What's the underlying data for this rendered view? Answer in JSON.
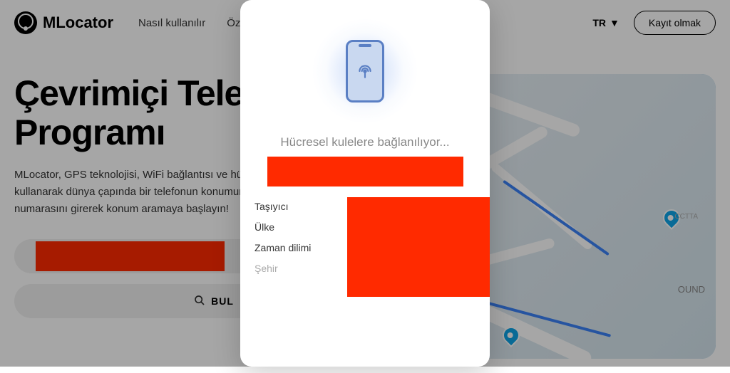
{
  "header": {
    "logo_text": "MLocator",
    "nav": [
      "Nasıl kullanılır",
      "Özellik"
    ],
    "lang": "TR",
    "signup": "Kayıt olmak"
  },
  "hero": {
    "title": "Çevrimiçi Telefon Takip Programı",
    "desc": "MLocator, GPS teknolojisi, WiFi bağlantısı ve hücresel sinyal üçgenlemesini kullanarak dünya çapında bir telefonun konumunu izler. Arama kutusuna telefon numarasını girerek konum aramaya başlayın!",
    "find_button": "BUL"
  },
  "map": {
    "label1": "OUND",
    "label2": "CCTTA"
  },
  "modal": {
    "status": "Hücresel kulelere bağlanılıyor...",
    "fields": {
      "carrier": "Taşıyıcı",
      "country": "Ülke",
      "timezone": "Zaman dilimi",
      "city": "Şehir"
    }
  }
}
